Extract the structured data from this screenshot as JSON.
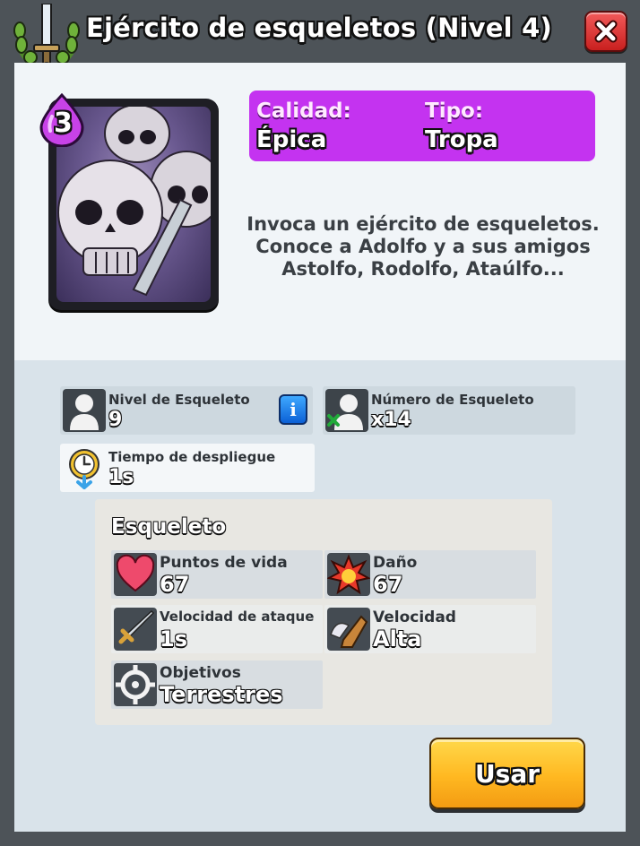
{
  "header": {
    "title": "Ejército de esqueletos (Nivel 4)",
    "logo_icon": "laurel-sword-icon",
    "close_icon": "close-x-icon",
    "close_color": "#e03232"
  },
  "card": {
    "elixir_cost": "3",
    "art": "skeleton-army-art"
  },
  "info": {
    "quality_label": "Calidad:",
    "quality_value": "Épica",
    "type_label": "Tipo:",
    "type_value": "Tropa",
    "color": "#c433f0"
  },
  "description": [
    "Invoca un ejército de esqueletos.",
    "Conoce a Adolfo y a sus amigos",
    "Astolfo, Rodolfo, Ataúlfo..."
  ],
  "stats": {
    "level": {
      "label": "Nivel de Esqueleto",
      "value": "9",
      "icon": "skeleton-silhouette-icon",
      "info_icon": "info-icon"
    },
    "count": {
      "label": "Número de Esqueleto",
      "value": "x14",
      "icon": "skeleton-count-icon"
    },
    "deploy": {
      "label": "Tiempo de despliegue",
      "value": "1s",
      "icon": "stopwatch-icon"
    }
  },
  "skeleton": {
    "title": "Esqueleto",
    "hitpoints": {
      "label": "Puntos de vida",
      "value": "67",
      "icon": "heart-icon"
    },
    "damage": {
      "label": "Daño",
      "value": "67",
      "icon": "explosion-icon"
    },
    "hit_speed": {
      "label": "Velocidad de ataque",
      "value": "1s",
      "icon": "sword-icon"
    },
    "speed": {
      "label": "Velocidad",
      "value": "Alta",
      "icon": "winged-boot-icon"
    },
    "targets": {
      "label": "Objetivos",
      "value": "Terrestres",
      "icon": "crosshair-icon"
    }
  },
  "use_button": {
    "label": "Usar",
    "color": "#ffb821"
  }
}
